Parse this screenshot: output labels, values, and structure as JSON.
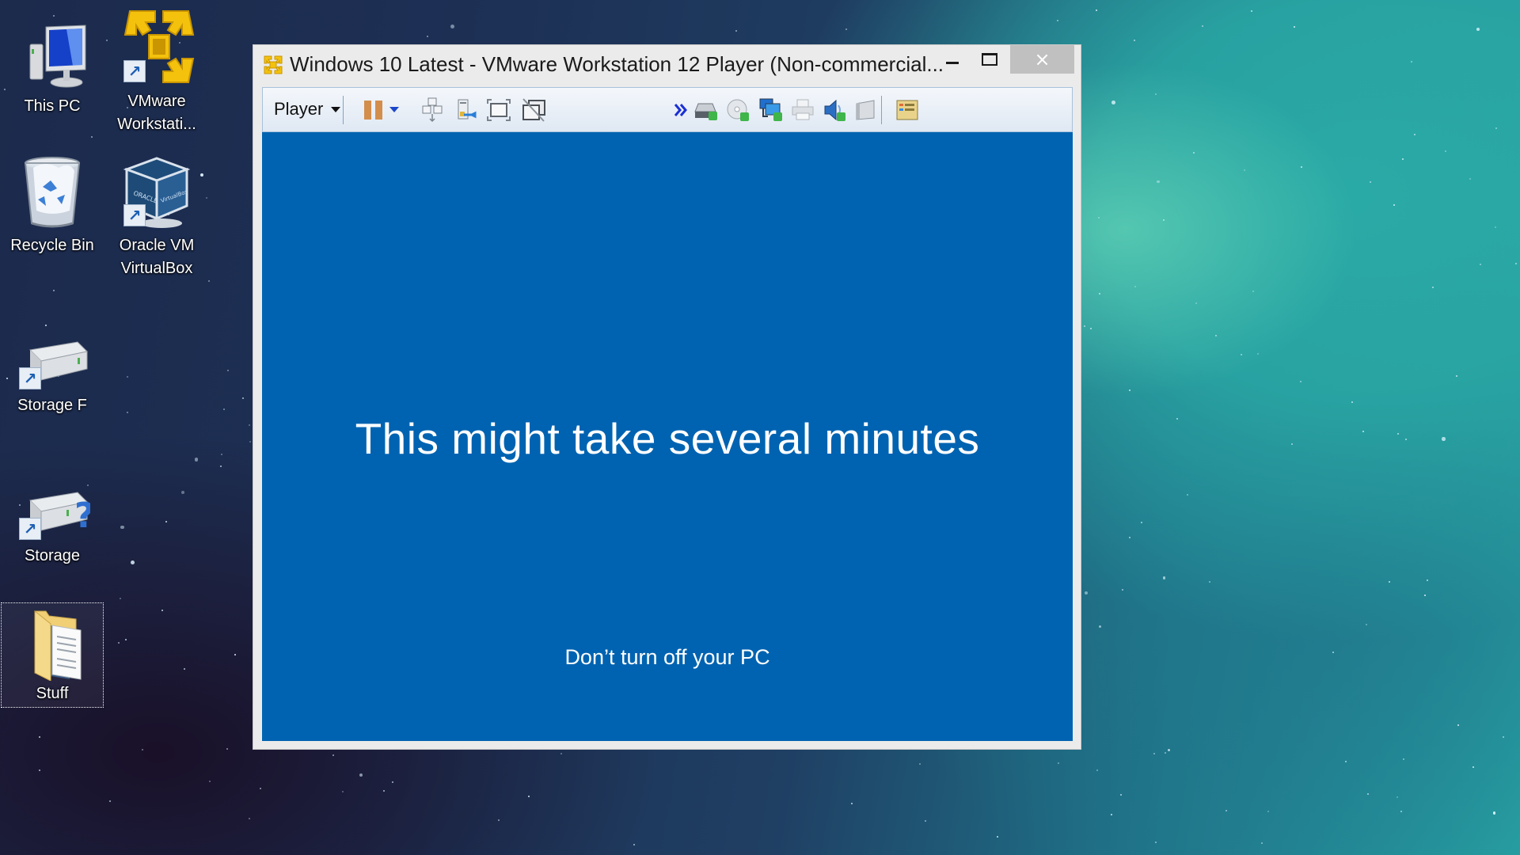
{
  "desktop": {
    "icons": [
      {
        "label": "This PC",
        "icon": "computer-icon",
        "shortcut": false,
        "selected": false
      },
      {
        "label": "VMware Workstati...",
        "icon": "vmware-icon",
        "shortcut": true,
        "selected": false
      },
      {
        "label": "Recycle Bin",
        "icon": "recycle-bin-icon",
        "shortcut": false,
        "selected": false
      },
      {
        "label": "Oracle VM VirtualBox",
        "icon": "virtualbox-icon",
        "shortcut": true,
        "selected": false
      },
      {
        "label": "Storage F",
        "icon": "drive-icon",
        "shortcut": true,
        "selected": false
      },
      {
        "label": "Storage",
        "icon": "drive-missing-icon",
        "shortcut": true,
        "selected": false
      },
      {
        "label": "Stuff",
        "icon": "folder-icon",
        "shortcut": false,
        "selected": true
      }
    ]
  },
  "window": {
    "title": "Windows 10 Latest - VMware Workstation 12 Player (Non-commercial...",
    "controls": {
      "minimize": "minimize",
      "maximize": "maximize",
      "close": "×"
    },
    "toolbar": {
      "player_menu": "Player",
      "buttons": [
        {
          "name": "pause",
          "tooltip": "Suspend/Pause"
        },
        {
          "name": "power-options",
          "tooltip": "Power options"
        },
        {
          "name": "send-ctrl-alt-del",
          "tooltip": "Send Ctrl+Alt+Del"
        },
        {
          "name": "removable-devices",
          "tooltip": "Removable devices"
        },
        {
          "name": "full-screen",
          "tooltip": "Enter full screen"
        },
        {
          "name": "unity",
          "tooltip": "Enter Unity"
        },
        {
          "name": "more",
          "tooltip": "More"
        },
        {
          "name": "hard-disk",
          "tooltip": "Hard Disk"
        },
        {
          "name": "cd-dvd",
          "tooltip": "CD/DVD"
        },
        {
          "name": "network-adapter",
          "tooltip": "Network Adapter"
        },
        {
          "name": "printer",
          "tooltip": "Printer"
        },
        {
          "name": "sound-card",
          "tooltip": "Sound Card"
        },
        {
          "name": "display",
          "tooltip": "Display"
        },
        {
          "name": "message-log",
          "tooltip": "Message log"
        }
      ]
    },
    "vm_screen": {
      "background": "#0063b1",
      "headline": "This might take several minutes",
      "subtext": "Don’t turn off your PC"
    }
  }
}
